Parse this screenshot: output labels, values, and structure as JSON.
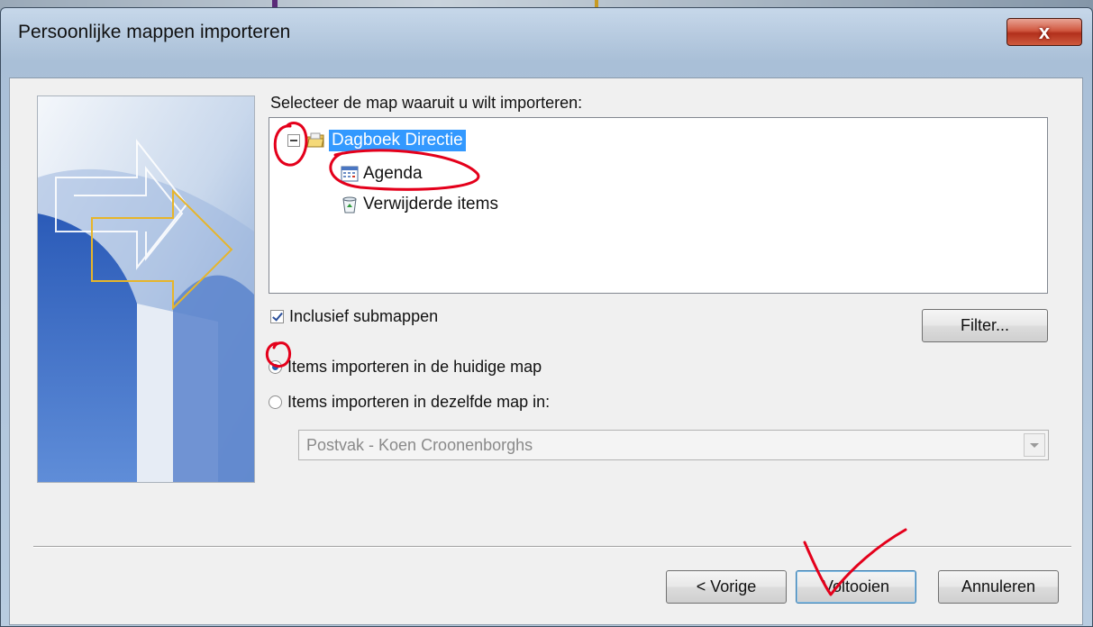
{
  "window": {
    "title": "Persoonlijke mappen importeren",
    "close_label": "x"
  },
  "prompt": "Selecteer de map waaruit u wilt importeren:",
  "tree": {
    "root": {
      "label": "Dagboek Directie",
      "icon": "archive-folder-icon",
      "expanded": true,
      "selected": true
    },
    "children": [
      {
        "label": "Agenda",
        "icon": "calendar-icon"
      },
      {
        "label": "Verwijderde items",
        "icon": "recycle-bin-icon"
      }
    ]
  },
  "options": {
    "include_subfolders": {
      "label": "Inclusief submappen",
      "checked": true
    },
    "filter_label": "Filter...",
    "radio_current": {
      "label": "Items importeren in de huidige map",
      "selected": true
    },
    "radio_same": {
      "label": "Items importeren in dezelfde map in:",
      "selected": false
    },
    "target_mailbox": "Postvak - Koen Croonenborghs"
  },
  "buttons": {
    "back": "< Vorige",
    "finish": "Voltooien",
    "cancel": "Annuleren"
  },
  "colors": {
    "selection": "#3399ff",
    "annotation": "#e4001b",
    "close": "#c7452c"
  }
}
